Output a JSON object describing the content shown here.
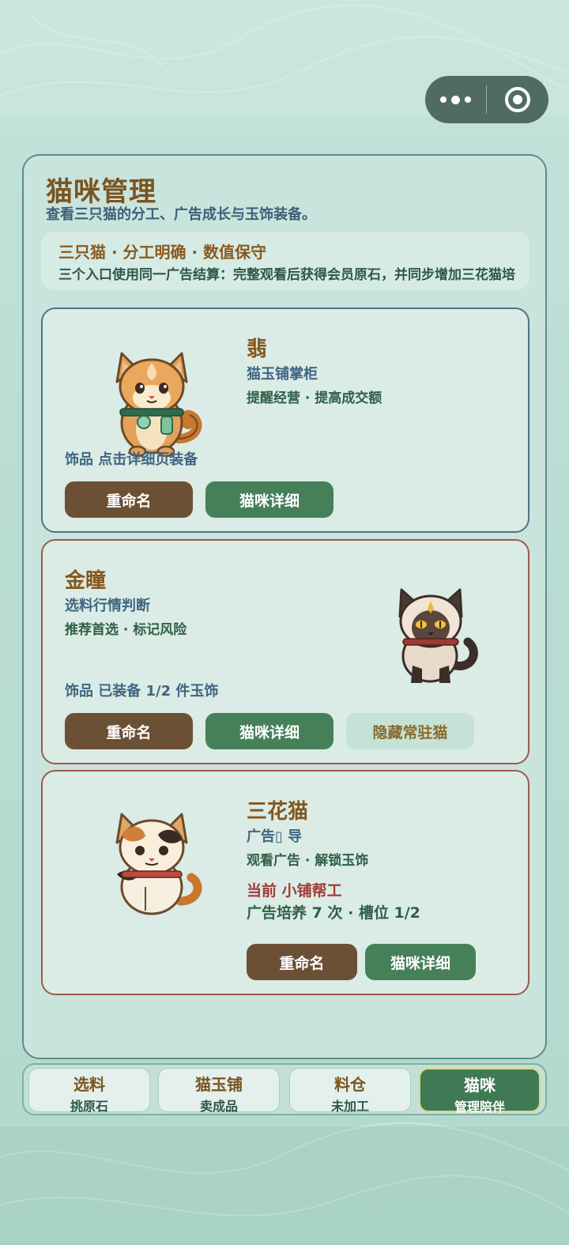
{
  "page": {
    "title": "猫咪管理",
    "subtitle": "查看三只猫的分工、广告成长与玉饰装备。"
  },
  "summary": {
    "title": "三只猫 · 分工明确 · 数值保守",
    "line": "三个入口使用同一广告结算：完整观看后获得会员原石，并同步增加三花猫培"
  },
  "cats": [
    {
      "name": "翡",
      "role": "猫玉铺掌柜",
      "trait": "提醒经营 · 提高成交额",
      "ornament": "饰品 点击详细页装备",
      "buttons": {
        "rename": "重命名",
        "detail": "猫咪详细"
      }
    },
    {
      "name": "金瞳",
      "role": "选料行情判断",
      "trait": "推荐首选 · 标记风险",
      "ornament": "饰品 已装备 1/2 件玉饰",
      "buttons": {
        "rename": "重命名",
        "detail": "猫咪详细",
        "hide": "隐藏常驻猫"
      }
    },
    {
      "name": "三花猫",
      "role": "广告▯ 导",
      "trait": "观看广告 · 解锁玉饰",
      "status": "当前 小铺帮工",
      "note": "广告培养 7 次 · 槽位 1/2",
      "buttons": {
        "rename": "重命名",
        "detail": "猫咪详细"
      }
    }
  ],
  "tabs": [
    {
      "label": "选料",
      "sub": "挑原石",
      "active": false
    },
    {
      "label": "猫玉铺",
      "sub": "卖成品",
      "active": false
    },
    {
      "label": "料仓",
      "sub": "未加工",
      "active": false
    },
    {
      "label": "猫咪",
      "sub": "管理陪伴",
      "active": true
    }
  ],
  "colors": {
    "background": "#c4e3da",
    "title_brown": "#7a5420",
    "button_brown": "#6c5035",
    "button_green": "#468059",
    "status_red": "#a03d35"
  }
}
